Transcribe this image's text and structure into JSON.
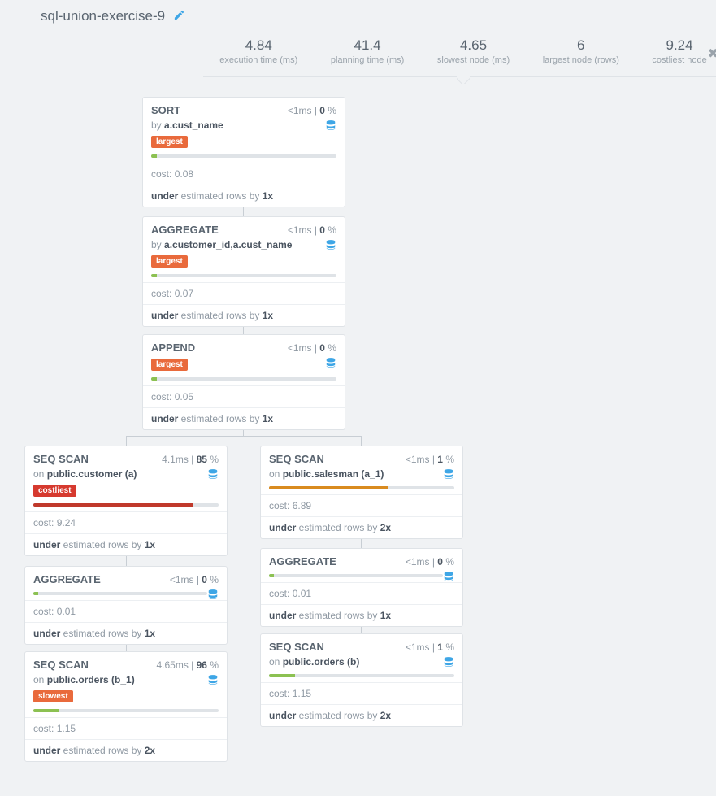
{
  "header": {
    "title": "sql-union-exercise-9"
  },
  "metrics": [
    {
      "value": "4.84",
      "label": "execution time (ms)"
    },
    {
      "value": "41.4",
      "label": "planning time (ms)"
    },
    {
      "value": "4.65",
      "label": "slowest node (ms)"
    },
    {
      "value": "6",
      "label": "largest node (rows)"
    },
    {
      "value": "9.24",
      "label": "costliest node"
    }
  ],
  "close_glyph": "✖",
  "nodes": {
    "sort": {
      "op": "SORT",
      "time_html": "<1",
      "time_unit": "ms",
      "pct": "0",
      "pct_unit": "%",
      "sub_prefix": "by ",
      "sub_bold": "a.cust_name",
      "tag": "largest",
      "bar_class": "green",
      "bar_width": "3%",
      "cost_label": "cost: ",
      "cost": "0.08",
      "est_prefix": "under",
      "est_mid": " estimated rows by ",
      "est_bold": "1x"
    },
    "agg1": {
      "op": "AGGREGATE",
      "time_html": "<1",
      "time_unit": "ms",
      "pct": "0",
      "pct_unit": "%",
      "sub_prefix": "by ",
      "sub_bold": "a.customer_id,a.cust_name",
      "tag": "largest",
      "bar_class": "green",
      "bar_width": "3%",
      "cost_label": "cost: ",
      "cost": "0.07",
      "est_prefix": "under",
      "est_mid": " estimated rows by ",
      "est_bold": "1x"
    },
    "append": {
      "op": "APPEND",
      "time_html": "<1",
      "time_unit": "ms",
      "pct": "0",
      "pct_unit": "%",
      "tag": "largest",
      "bar_class": "green",
      "bar_width": "3%",
      "cost_label": "cost: ",
      "cost": "0.05",
      "est_prefix": "under",
      "est_mid": " estimated rows by ",
      "est_bold": "1x"
    },
    "seqL1": {
      "op": "SEQ SCAN",
      "time_html": "4.1",
      "time_unit": "ms",
      "pct": "85",
      "pct_unit": "%",
      "sub_prefix": "on ",
      "sub_bold": "public.customer (a)",
      "tag": "costliest",
      "bar_class": "red",
      "bar_width": "86%",
      "cost_label": "cost: ",
      "cost": "9.24",
      "est_prefix": "under",
      "est_mid": " estimated rows by ",
      "est_bold": "1x"
    },
    "aggL": {
      "op": "AGGREGATE",
      "time_html": "<1",
      "time_unit": "ms",
      "pct": "0",
      "pct_unit": "%",
      "bar_class": "green",
      "bar_width": "3%",
      "cost_label": "cost: ",
      "cost": "0.01",
      "est_prefix": "under",
      "est_mid": " estimated rows by ",
      "est_bold": "1x"
    },
    "seqL2": {
      "op": "SEQ SCAN",
      "time_html": "4.65",
      "time_unit": "ms",
      "pct": "96",
      "pct_unit": "%",
      "sub_prefix": "on ",
      "sub_bold": "public.orders (b_1)",
      "tag": "slowest",
      "bar_class": "green",
      "bar_width": "14%",
      "cost_label": "cost: ",
      "cost": "1.15",
      "est_prefix": "under",
      "est_mid": " estimated rows by ",
      "est_bold": "2x"
    },
    "seqR1": {
      "op": "SEQ SCAN",
      "time_html": "<1",
      "time_unit": "ms",
      "pct": "1",
      "pct_unit": "%",
      "sub_prefix": "on ",
      "sub_bold": "public.salesman (a_1)",
      "bar_class": "orange",
      "bar_width": "64%",
      "cost_label": "cost: ",
      "cost": "6.89",
      "est_prefix": "under",
      "est_mid": " estimated rows by ",
      "est_bold": "2x"
    },
    "aggR": {
      "op": "AGGREGATE",
      "time_html": "<1",
      "time_unit": "ms",
      "pct": "0",
      "pct_unit": "%",
      "bar_class": "green",
      "bar_width": "3%",
      "cost_label": "cost: ",
      "cost": "0.01",
      "est_prefix": "under",
      "est_mid": " estimated rows by ",
      "est_bold": "1x"
    },
    "seqR2": {
      "op": "SEQ SCAN",
      "time_html": "<1",
      "time_unit": "ms",
      "pct": "1",
      "pct_unit": "%",
      "sub_prefix": "on ",
      "sub_bold": "public.orders (b)",
      "bar_class": "green",
      "bar_width": "14%",
      "cost_label": "cost: ",
      "cost": "1.15",
      "est_prefix": "under",
      "est_mid": " estimated rows by ",
      "est_bold": "2x"
    }
  }
}
